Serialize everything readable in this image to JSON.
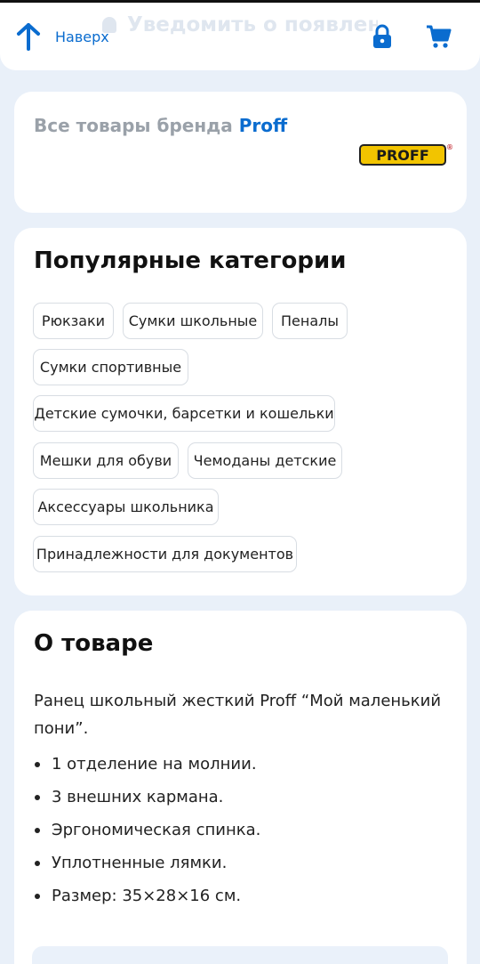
{
  "header": {
    "back_to_top_label": "Наверх",
    "notify_ghost_text": "Уведомить о появлении",
    "lock_icon": "lock-icon",
    "cart_icon": "cart-icon",
    "accent_color": "#0a6ccf"
  },
  "brand": {
    "prefix": "Все товары бренда",
    "name": "Proff",
    "logo_text": "PROFF",
    "logo_registered": "®"
  },
  "categories": {
    "title": "Популярные категории",
    "items": [
      "Рюкзаки",
      "Сумки школьные",
      "Пеналы",
      "Сумки спортивные",
      "Детские сумочки, барсетки и кошельки",
      "Мешки для обуви",
      "Чемоданы детские",
      "Аксессуары школьника",
      "Принадлежности для документов"
    ]
  },
  "about": {
    "title": "О товаре",
    "description": "Ранец школьный жесткий Proff “Мой маленький пони”.",
    "features": [
      "1 отделение на молнии.",
      "3 внешних кармана.",
      "Эргономическая спинка.",
      "Уплотненные лямки.",
      "Размер: 35×28×16 см."
    ]
  }
}
